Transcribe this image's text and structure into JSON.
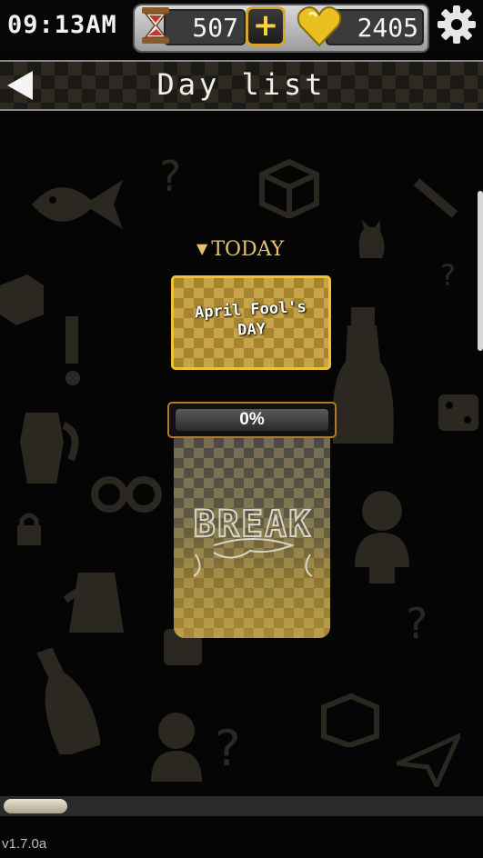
{
  "status_bar": {
    "time": "09:13AM",
    "sand_count": "507",
    "plus_label": "+",
    "heart_count": "2405"
  },
  "header": {
    "title": "Day list",
    "back_icon": "back-arrow-icon"
  },
  "today": {
    "label": "TODAY",
    "event_line1": "April Fool's",
    "event_line2": "DAY",
    "progress_text": "0%",
    "progress_fraction": 0,
    "story_logo_text": "BREAK"
  },
  "footer": {
    "version": "v1.7.0a"
  },
  "colors": {
    "accent_gold": "#f0c233",
    "panel_gold": "#a7852f",
    "background": "#050505"
  }
}
